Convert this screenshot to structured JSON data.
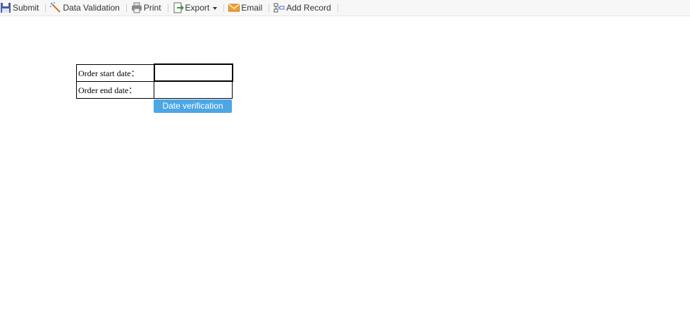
{
  "toolbar": {
    "items": [
      {
        "label": "Submit",
        "icon": "save-icon"
      },
      {
        "label": "Data Validation",
        "icon": "validate-wand-icon"
      },
      {
        "label": "Print",
        "icon": "printer-icon"
      },
      {
        "label": "Export",
        "icon": "export-icon",
        "has_dropdown": true
      },
      {
        "label": "Email",
        "icon": "envelope-icon"
      },
      {
        "label": "Add Record",
        "icon": "add-record-icon"
      }
    ]
  },
  "form": {
    "start_date": {
      "label": "Order start date：",
      "value": ""
    },
    "end_date": {
      "label": "Order end date：",
      "value": ""
    },
    "verify_button": "Date verification"
  },
  "colors": {
    "toolbar_bg": "#f7f7f7",
    "button_accent": "#4ba7e6",
    "save_icon": "#4a5ea8",
    "email_icon": "#f0a030",
    "export_icon": "#3a9a3a"
  }
}
